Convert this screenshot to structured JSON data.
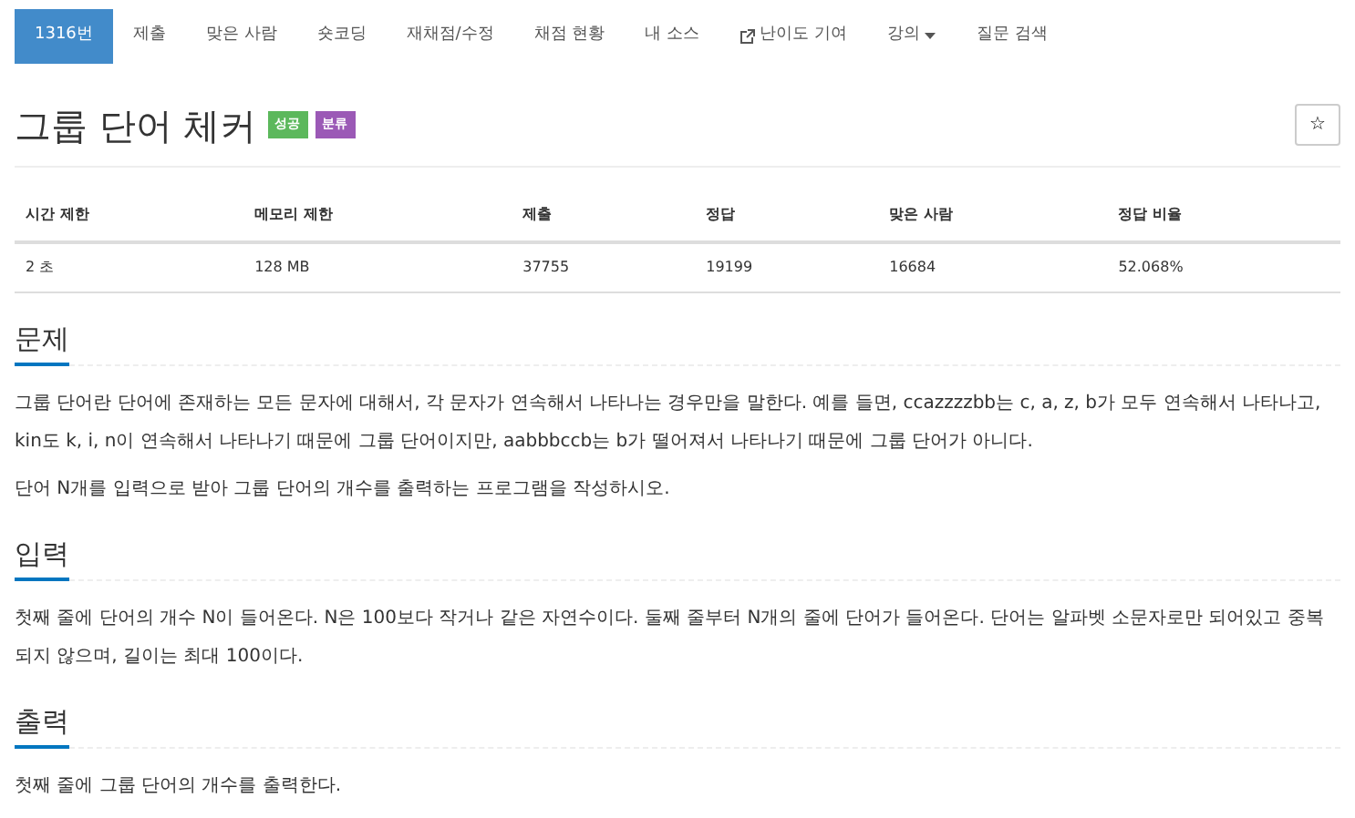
{
  "tabs": [
    {
      "label": "1316번",
      "selected": true,
      "kind": "plain"
    },
    {
      "label": "제출",
      "selected": false,
      "kind": "plain"
    },
    {
      "label": "맞은 사람",
      "selected": false,
      "kind": "plain"
    },
    {
      "label": "숏코딩",
      "selected": false,
      "kind": "plain"
    },
    {
      "label": "재채점/수정",
      "selected": false,
      "kind": "plain"
    },
    {
      "label": "채점 현황",
      "selected": false,
      "kind": "plain"
    },
    {
      "label": "내 소스",
      "selected": false,
      "kind": "plain"
    },
    {
      "label": "난이도 기여",
      "selected": false,
      "kind": "external"
    },
    {
      "label": "강의",
      "selected": false,
      "kind": "dropdown"
    },
    {
      "label": "질문 검색",
      "selected": false,
      "kind": "plain"
    }
  ],
  "title": "그룹 단어 체커",
  "labels": [
    {
      "text": "성공",
      "color": "#5cb85c"
    },
    {
      "text": "분류",
      "color": "#9b59b6"
    }
  ],
  "star_button": "☆",
  "table": {
    "columns": [
      "시간 제한",
      "메모리 제한",
      "제출",
      "정답",
      "맞은 사람",
      "정답 비율"
    ],
    "rows": [
      [
        "2 초",
        "128 MB",
        "37755",
        "19199",
        "16684",
        "52.068%"
      ]
    ]
  },
  "sections": [
    {
      "heading": "문제",
      "paragraphs": [
        "그룹 단어란 단어에 존재하는 모든 문자에 대해서, 각 문자가 연속해서 나타나는 경우만을 말한다. 예를 들면, ccazzzzbb는 c, a, z, b가 모두 연속해서 나타나고, kin도 k, i, n이 연속해서 나타나기 때문에 그룹 단어이지만, aabbbccb는 b가 떨어져서 나타나기 때문에 그룹 단어가 아니다.",
        "단어 N개를 입력으로 받아 그룹 단어의 개수를 출력하는 프로그램을 작성하시오."
      ]
    },
    {
      "heading": "입력",
      "paragraphs": [
        "첫째 줄에 단어의 개수 N이 들어온다. N은 100보다 작거나 같은 자연수이다. 둘째 줄부터 N개의 줄에 단어가 들어온다. 단어는 알파벳 소문자로만 되어있고 중복되지 않으며, 길이는 최대 100이다."
      ]
    },
    {
      "heading": "출력",
      "paragraphs": [
        "첫째 줄에 그룹 단어의 개수를 출력한다."
      ]
    }
  ]
}
